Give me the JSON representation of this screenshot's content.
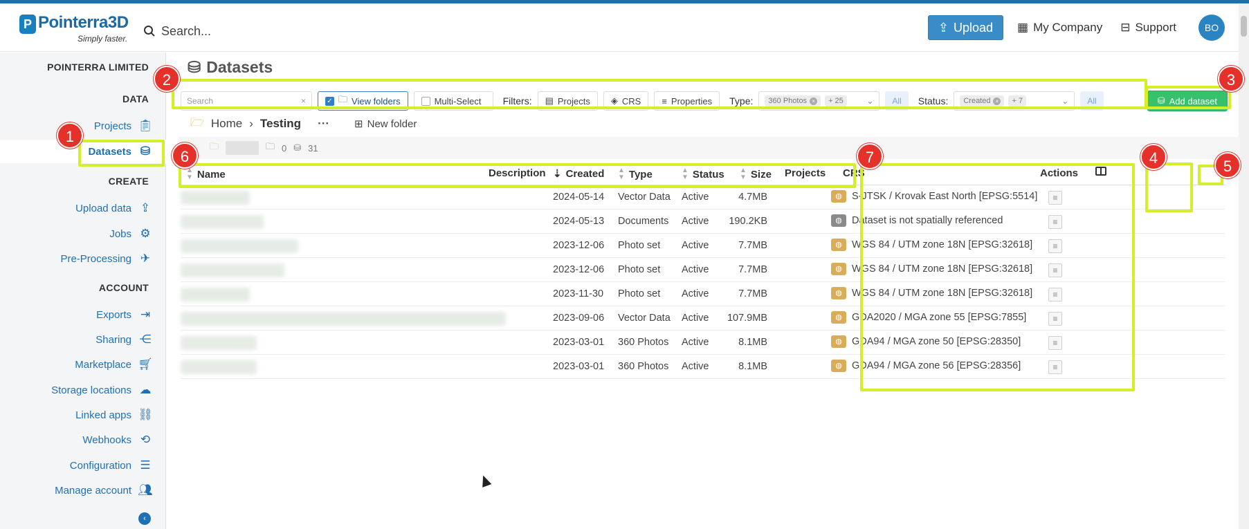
{
  "brand": {
    "name": "Pointerra3D",
    "tagline": "Simply faster."
  },
  "topbar": {
    "search_placeholder": "Search...",
    "upload_label": "Upload",
    "company_label": "My Company",
    "support_label": "Support",
    "avatar_initials": "BO"
  },
  "sidebar": {
    "org": "POINTERRA LIMITED",
    "data_heading": "DATA",
    "projects": "Projects",
    "datasets": "Datasets",
    "create_heading": "CREATE",
    "upload_data": "Upload data",
    "jobs": "Jobs",
    "preprocessing": "Pre-Processing",
    "account_heading": "ACCOUNT",
    "exports": "Exports",
    "sharing": "Sharing",
    "marketplace": "Marketplace",
    "storage_locations": "Storage locations",
    "linked_apps": "Linked apps",
    "webhooks": "Webhooks",
    "configuration": "Configuration",
    "manage_account": "Manage account"
  },
  "page": {
    "title": "Datasets"
  },
  "toolbar": {
    "search_placeholder": "Search",
    "view_folders": "View folders",
    "multi_select": "Multi-Select",
    "filters_label": "Filters:",
    "projects_filter": "Projects",
    "crs_filter": "CRS",
    "properties_filter": "Properties",
    "type_label": "Type:",
    "type_chip": "360 Photos",
    "type_more": "+ 25",
    "status_label": "Status:",
    "status_chip": "Created",
    "status_more": "+ 7",
    "all_label": "All",
    "add_dataset": "Add dataset"
  },
  "breadcrumb": {
    "home": "Home",
    "current": "Testing",
    "more": "···",
    "new_folder": "New folder"
  },
  "subfolder": {
    "folders": "0",
    "datasets": "31"
  },
  "table": {
    "headers": {
      "name": "Name",
      "description": "Description",
      "created": "Created",
      "type": "Type",
      "status": "Status",
      "size": "Size",
      "projects": "Projects",
      "crs": "CRS",
      "actions": "Actions"
    },
    "rows": [
      {
        "created": "2024-05-14",
        "type": "Vector Data",
        "status": "Active",
        "size": "4.7MB",
        "crs": "S-JTSK / Krovak East North [EPSG:5514]",
        "referenced": true
      },
      {
        "created": "2024-05-13",
        "type": "Documents",
        "status": "Active",
        "size": "190.2KB",
        "crs": "Dataset is not spatially referenced",
        "referenced": false
      },
      {
        "created": "2023-12-06",
        "type": "Photo set",
        "status": "Active",
        "size": "7.7MB",
        "crs": "WGS 84 / UTM zone 18N [EPSG:32618]",
        "referenced": true
      },
      {
        "created": "2023-12-06",
        "type": "Photo set",
        "status": "Active",
        "size": "7.7MB",
        "crs": "WGS 84 / UTM zone 18N [EPSG:32618]",
        "referenced": true
      },
      {
        "created": "2023-11-30",
        "type": "Photo set",
        "status": "Active",
        "size": "7.7MB",
        "crs": "WGS 84 / UTM zone 18N [EPSG:32618]",
        "referenced": true
      },
      {
        "created": "2023-09-06",
        "type": "Vector Data",
        "status": "Active",
        "size": "107.9MB",
        "crs": "GDA2020 / MGA zone 55 [EPSG:7855]",
        "referenced": true
      },
      {
        "created": "2023-03-01",
        "type": "360 Photos",
        "status": "Active",
        "size": "8.1MB",
        "crs": "GDA94 / MGA zone 50 [EPSG:28350]",
        "referenced": true
      },
      {
        "created": "2023-03-01",
        "type": "360 Photos",
        "status": "Active",
        "size": "8.1MB",
        "crs": "GDA94 / MGA zone 56 [EPSG:28356]",
        "referenced": true
      }
    ]
  },
  "annotations": {
    "b1": "1",
    "b2": "2",
    "b3": "3",
    "b4": "4",
    "b5": "5",
    "b6": "6",
    "b7": "7",
    "highlight_color": "#d4ef2a",
    "badge_color": "#e4322b"
  }
}
